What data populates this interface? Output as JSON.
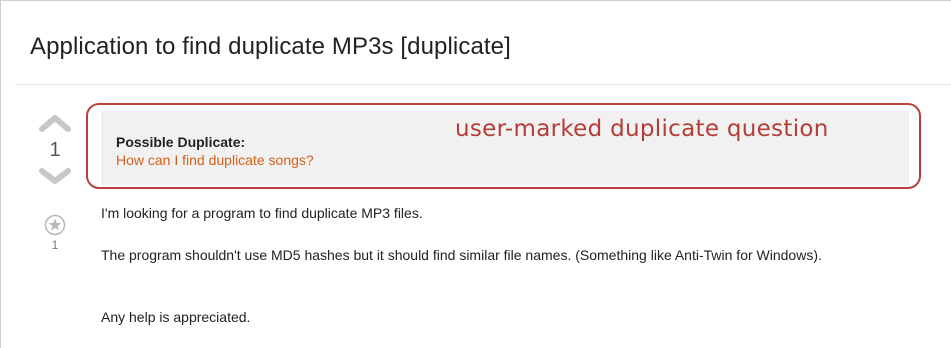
{
  "question": {
    "title": "Application to find duplicate MP3s [duplicate]",
    "votes": "1",
    "favorites": "1",
    "icons": {
      "upvote": "arrow-up-icon",
      "downvote": "arrow-down-icon",
      "favorite": "star-icon"
    }
  },
  "duplicate_notice": {
    "heading": "Possible Duplicate:",
    "link_text": "How can I find duplicate songs?"
  },
  "annotation": {
    "label": "user-marked duplicate question",
    "color": "#b8413a"
  },
  "body": {
    "paragraphs": [
      "I'm looking for a program to find duplicate MP3 files.",
      "The program shouldn't use MD5 hashes but it should find similar file names. (Something like Anti-Twin for Windows).",
      "Any help is appreciated."
    ]
  },
  "colors": {
    "link": "#d4601b",
    "notice_bg": "#f1f1f1",
    "vote_arrow": "#c7c7c7"
  }
}
